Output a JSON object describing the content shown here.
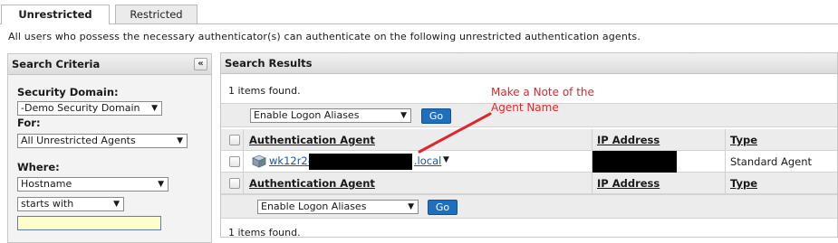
{
  "tabs": [
    {
      "label": "Unrestricted",
      "active": true
    },
    {
      "label": "Restricted",
      "active": false
    }
  ],
  "description": "All users who possess the necessary authenticator(s) can authenticate on the following unrestricted authentication agents.",
  "search_criteria": {
    "title": "Search Criteria",
    "collapse_glyph": "«",
    "security_domain_label": "Security Domain:",
    "security_domain_value": "-Demo Security Domain",
    "for_label": "For:",
    "for_value": "All Unrestricted Agents",
    "where_label": "Where:",
    "where_field_value": "Hostname",
    "where_operator_value": "starts with",
    "where_text_value": ""
  },
  "search_results": {
    "title": "Search Results",
    "count_text": "1 items found.",
    "action_value": "Enable Logon Aliases",
    "go_label": "Go",
    "columns": [
      "Authentication Agent",
      "IP Address",
      "Type"
    ],
    "rows": [
      {
        "agent_prefix": "wk12r2-",
        "agent_suffix": ".local",
        "type": "Standard Agent"
      }
    ]
  },
  "annotation": {
    "line1": "Make a Note of the",
    "line2": "Agent Name",
    "color": "#e0262b"
  },
  "colors": {
    "link": "#1e56a0",
    "go_button": "#1f6fc0",
    "input_highlight": "#ffffcc"
  }
}
